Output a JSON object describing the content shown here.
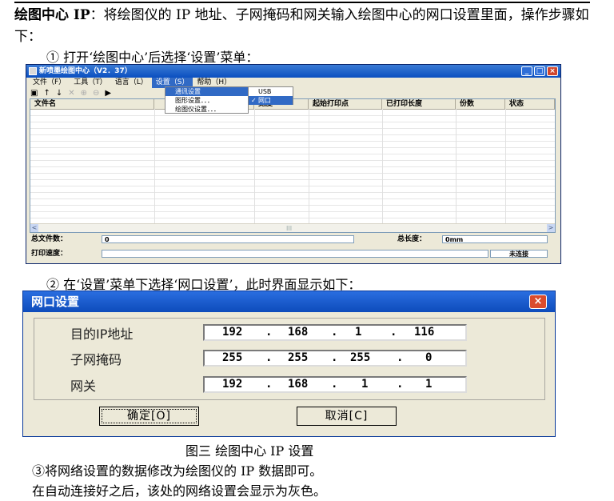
{
  "intro": {
    "bold": "绘图中心 IP",
    "text": "：将绘图仪的 IP 地址、子网掩码和网关输入绘图中心的网口设置里面，操作步骤如下："
  },
  "step1": "① 打开‘绘图中心’后选择‘设置’菜单：",
  "app": {
    "title": "新喷墨绘图中心（V2．37）",
    "win_buttons": {
      "min": "_",
      "max": "□",
      "close": "×"
    },
    "menus": [
      "文件（F）",
      "工具（T）",
      "语言（L）",
      "设置（S）",
      "帮助（H）"
    ],
    "toolbar": [
      "▣",
      "↑",
      "↓",
      "✕",
      "⊕",
      "⊖",
      "▶"
    ],
    "columns": [
      "文件名",
      "",
      "宽度",
      "起始打印点",
      "已打印长度",
      "份数",
      "状态"
    ],
    "dropdown": [
      "通讯设置",
      "图形设置．．．",
      "绘图仪设置．．．"
    ],
    "submenu": [
      "USB",
      "网口"
    ],
    "submenu_check": "✓",
    "scroll": {
      "left": "<",
      "right": ">",
      "grip": "III"
    },
    "status": {
      "total_files_label": "总文件数：",
      "total_files_value": "0",
      "total_length_label": "总长度：",
      "total_length_value": "0mm",
      "print_speed_label": "打印速度：",
      "connection": "未连接"
    }
  },
  "step2": "② 在‘设置’菜单下选择‘网口设置’，此时界面显示如下：",
  "dialog": {
    "title": "网口设置",
    "close": "×",
    "fields": [
      {
        "label": "目的IP地址",
        "octets": [
          "192",
          "168",
          "1",
          "116"
        ]
      },
      {
        "label": "子网掩码",
        "octets": [
          "255",
          "255",
          "255",
          "0"
        ]
      },
      {
        "label": "网关",
        "octets": [
          "192",
          "168",
          "1",
          "1"
        ]
      }
    ],
    "dot": ".",
    "ok": "确定[O]",
    "cancel": "取消[C]"
  },
  "caption": "图三 绘图中心 IP 设置",
  "step3": "③将网络设置的数据修改为绘图仪的 IP 数据即可。",
  "note": "在自动连接好之后，该处的网络设置会显示为灰色。"
}
